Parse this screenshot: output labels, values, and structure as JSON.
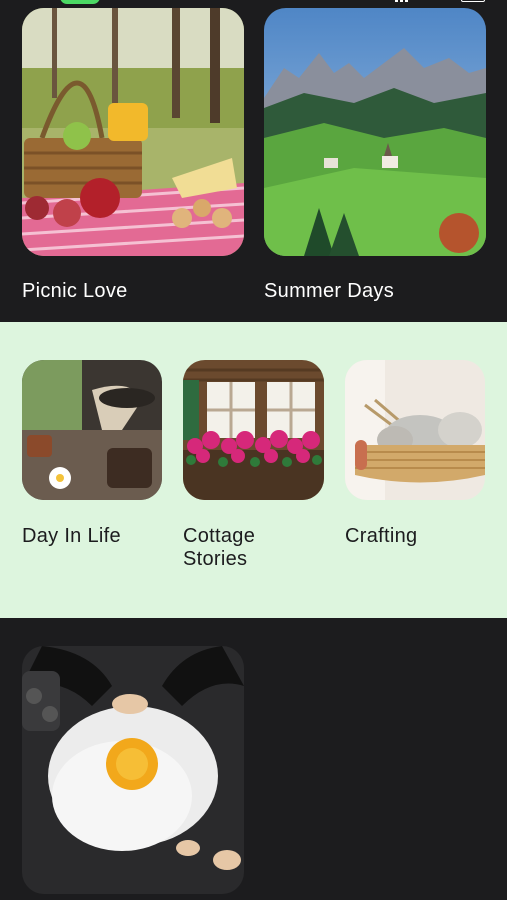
{
  "section_top": {
    "cards": [
      {
        "id": "picnic-love",
        "label": "Picnic Love"
      },
      {
        "id": "summer-days",
        "label": "Summer Days"
      }
    ]
  },
  "section_middle": {
    "cards": [
      {
        "id": "day-in-life",
        "label": "Day In Life"
      },
      {
        "id": "cottage-stories",
        "label": "Cottage\nStories"
      },
      {
        "id": "crafting",
        "label": "Crafting"
      }
    ]
  },
  "section_bottom": {
    "cards": [
      {
        "id": "baking",
        "label": ""
      }
    ]
  },
  "colors": {
    "background": "#1c1c1e",
    "band": "#ddf5de",
    "status_pill": "#4cd964"
  }
}
